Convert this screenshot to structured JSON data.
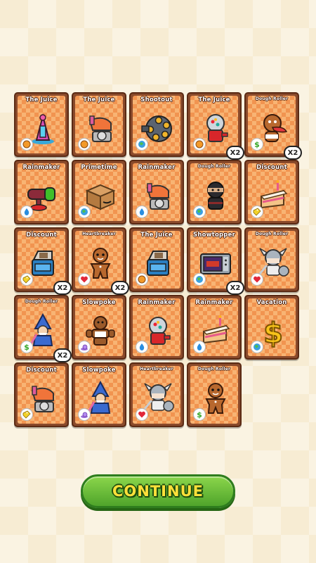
{
  "cards": [
    {
      "title": "The Juice",
      "art": "juice-machine-icon",
      "badge": "orange-orb-icon",
      "multiplier": null
    },
    {
      "title": "The Juice",
      "art": "pink-mixer-icon",
      "badge": "orange-orb-icon",
      "multiplier": null
    },
    {
      "title": "Shootout",
      "art": "revolver-cylinder-icon",
      "badge": "globe-icon",
      "multiplier": null
    },
    {
      "title": "The Juice",
      "art": "gumball-machine-icon",
      "badge": "orange-orb-icon",
      "multiplier": "X2"
    },
    {
      "title": "Dough Roller",
      "art": "gingerbread-tongue-icon",
      "badge": "green-dollar-icon",
      "multiplier": "X2"
    },
    {
      "title": "Rainmaker",
      "art": "green-cannon-icon",
      "badge": "water-drop-icon",
      "multiplier": null
    },
    {
      "title": "Primetime",
      "art": "cardboard-box-icon",
      "badge": "globe-icon",
      "multiplier": null
    },
    {
      "title": "Rainmaker",
      "art": "pink-mixer-icon",
      "badge": "water-drop-icon",
      "multiplier": null
    },
    {
      "title": "Dough Roller",
      "art": "ninja-icon",
      "badge": "globe-icon",
      "multiplier": null
    },
    {
      "title": "Discount",
      "art": "cake-slice-icon",
      "badge": "yellow-tag-icon",
      "multiplier": null
    },
    {
      "title": "Discount",
      "art": "blue-blender-icon",
      "badge": "yellow-tag-icon",
      "multiplier": "X2"
    },
    {
      "title": "Heartbreaker",
      "art": "gingerbread-man-icon",
      "badge": "heart-icon",
      "multiplier": "X2"
    },
    {
      "title": "The Juice",
      "art": "blue-blender-icon",
      "badge": "orange-orb-icon",
      "multiplier": null
    },
    {
      "title": "Showtopper",
      "art": "microwave-icon",
      "badge": "globe-icon",
      "multiplier": "X2"
    },
    {
      "title": "Dough Roller",
      "art": "viking-warrior-icon",
      "badge": "heart-icon",
      "multiplier": null
    },
    {
      "title": "Dough Roller",
      "art": "wizard-icon",
      "badge": "green-dollar-icon",
      "multiplier": "X2"
    },
    {
      "title": "Slowpoke",
      "art": "gingerbread-strongman-icon",
      "badge": "purple-snail-icon",
      "multiplier": null
    },
    {
      "title": "Rainmaker",
      "art": "gumball-machine-icon",
      "badge": "water-drop-icon",
      "multiplier": null
    },
    {
      "title": "Rainmaker",
      "art": "cake-slice-icon",
      "badge": "water-drop-icon",
      "multiplier": null
    },
    {
      "title": "Vacation",
      "art": "gold-dollar-icon",
      "badge": "globe-icon",
      "multiplier": null
    },
    {
      "title": "Discount",
      "art": "pink-mixer-icon",
      "badge": "yellow-tag-icon",
      "multiplier": null
    },
    {
      "title": "Slowpoke",
      "art": "wizard-icon",
      "badge": "purple-snail-icon",
      "multiplier": null
    },
    {
      "title": "Heartbreaker",
      "art": "viking-warrior-icon",
      "badge": "heart-icon",
      "multiplier": null
    },
    {
      "title": "Dough Roller",
      "art": "gingerbread-man-icon",
      "badge": "green-dollar-icon",
      "multiplier": null
    }
  ],
  "continue_label": "CONTINUE",
  "colors": {
    "card_bg": "#f19450",
    "card_border": "#8a4a2b",
    "button_green": "#4fa42b",
    "button_text": "#ffe03a"
  }
}
